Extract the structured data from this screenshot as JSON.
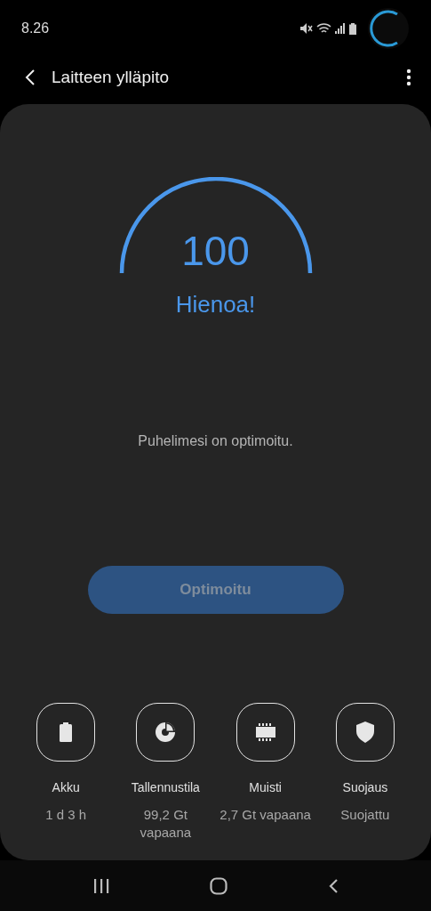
{
  "status_bar": {
    "time": "8.26"
  },
  "header": {
    "title": "Laitteen ylläpito"
  },
  "score": {
    "value": "100",
    "rating": "Hienoa!"
  },
  "message": "Puhelimesi on optimoitu.",
  "action_button": {
    "label": "Optimoitu",
    "disabled": true
  },
  "categories": [
    {
      "kind": "battery",
      "label": "Akku",
      "value": "1 d 3 h"
    },
    {
      "kind": "storage",
      "label": "Tallennustila",
      "value": "99,2 Gt vapaana"
    },
    {
      "kind": "memory",
      "label": "Muisti",
      "value": "2,7 Gt vapaana"
    },
    {
      "kind": "security",
      "label": "Suojaus",
      "value": "Suojattu"
    }
  ]
}
